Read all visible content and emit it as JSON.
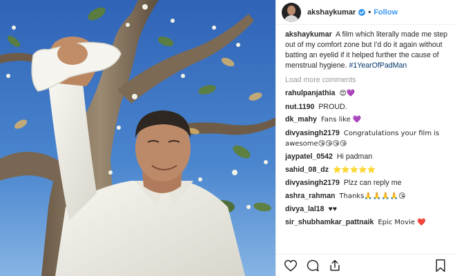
{
  "header": {
    "username": "akshaykumar",
    "separator": "•",
    "follow_label": "Follow",
    "icons": {
      "verified": "verified-badge-icon",
      "avatar": "avatar"
    },
    "colors": {
      "follow": "#3897f0",
      "verified": "#3897f0"
    }
  },
  "caption": {
    "username": "akshaykumar",
    "text": "A film which literally made me step out of my comfort zone but I'd do it again without batting an eyelid if it helped further the cause of menstrual hygiene.",
    "hashtag": "#1YearOfPadMan"
  },
  "load_more_label": "Load more comments",
  "comments": [
    {
      "username": "rahulpanjathia",
      "text": "😍💜"
    },
    {
      "username": "nut.1190",
      "text": "PROUD."
    },
    {
      "username": "dk_mahy",
      "text": "Fans like 💜"
    },
    {
      "username": "divyasingh2179",
      "text": "Congratulations your film is awesome😘😘😘😘"
    },
    {
      "username": "jaypatel_0542",
      "text": "Hi padman"
    },
    {
      "username": "sahid_08_dz",
      "text": "⭐⭐⭐⭐⭐"
    },
    {
      "username": "divyasingh2179",
      "text": "Plzz can reply me"
    },
    {
      "username": "ashra_rahman",
      "text": "Thanks🙏🙏🙏🙏😘"
    },
    {
      "username": "divya_lal18",
      "text": "♥♥"
    },
    {
      "username": "sir_shubhamkar_pattnaik",
      "text": "Epic Movie ❤️"
    }
  ],
  "actions": {
    "icons": [
      "heart-icon",
      "comment-icon",
      "share-icon",
      "bookmark-icon"
    ]
  }
}
